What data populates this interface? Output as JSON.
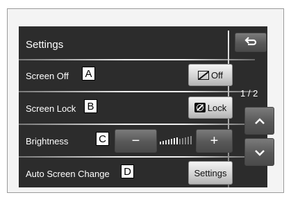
{
  "header": {
    "title": "Settings",
    "back_icon": "back-arrow-icon"
  },
  "rows": [
    {
      "label": "Screen Off",
      "tag": "A",
      "button_label": "Off",
      "button_icon": "screen-off-icon"
    },
    {
      "label": "Screen Lock",
      "tag": "B",
      "button_label": "Lock",
      "button_icon": "lock-icon"
    },
    {
      "label": "Brightness",
      "tag": "C",
      "minus_label": "−",
      "plus_label": "+"
    },
    {
      "label": "Auto Screen Change",
      "tag": "D",
      "button_label": "Settings"
    }
  ],
  "pager": {
    "page": "1 / 2",
    "up_icon": "chevron-up-icon",
    "down_icon": "chevron-down-icon"
  }
}
